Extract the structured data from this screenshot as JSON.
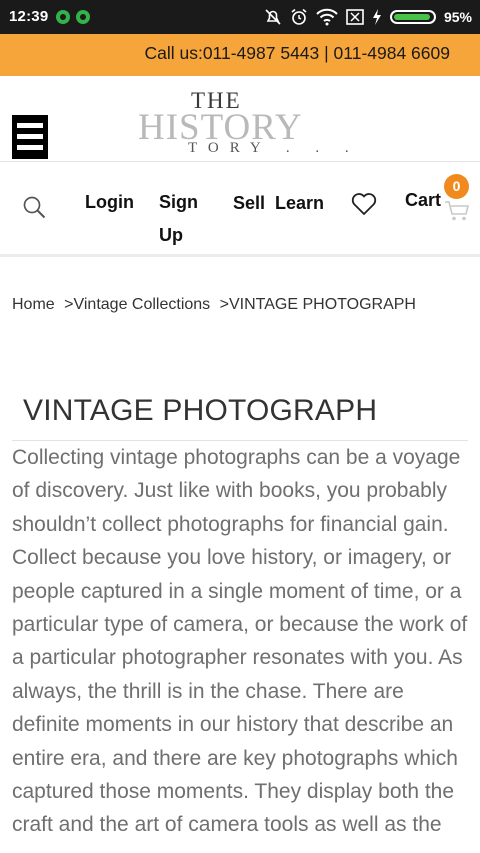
{
  "status_bar": {
    "time": "12:39",
    "battery_percent": "95%",
    "battery_level": 0.95
  },
  "callbar": {
    "text": "Call us:011-4987 5443 | 011-4984 6609"
  },
  "header": {
    "logo": {
      "the": "THE",
      "main": "HISTORY",
      "sub": "TORY . . ."
    }
  },
  "nav": {
    "login": "Login",
    "signup_line1": "Sign",
    "signup_line2": "Up",
    "sell": "Sell",
    "learn": "Learn",
    "cart": "Cart",
    "cart_count": "0"
  },
  "breadcrumb": {
    "home": "Home",
    "sep1": ">",
    "collections": "Vintage Collections",
    "sep2": ">",
    "current": "VINTAGE PHOTOGRAPH"
  },
  "article": {
    "title": "VINTAGE PHOTOGRAPH",
    "body": "Collecting vintage photographs can be a voyage of discovery.  Just like with books, you probably shouldn’t collect photographs for financial gain. Collect because you love history, or imagery, or people captured in a single moment of time, or a particular type of camera, or because the work of a particular photographer resonates with you.  As always, the thrill is in the chase. There are definite moments in our history that describe an entire era, and there are key photographs which captured those moments. They display both the craft and the art of camera tools as well as the"
  },
  "colors": {
    "callbar_bg": "#f6a53a",
    "cart_badge": "#f08a1e",
    "status_bar_bg": "#1a1a1a"
  },
  "icons": [
    "silent-icon",
    "alarm-icon",
    "wifi-icon",
    "sim-icon",
    "charging-icon",
    "menu-icon",
    "search-icon",
    "heart-icon",
    "cart-icon"
  ]
}
